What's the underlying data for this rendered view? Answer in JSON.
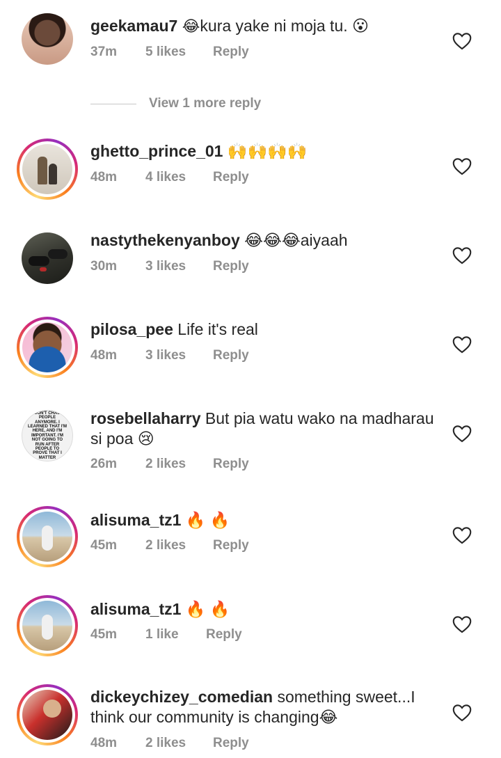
{
  "view_more": "View 1 more reply",
  "comments": [
    {
      "user": "geekamau7",
      "pre": "😂",
      "text": "kura yake ni moja tu. 😮",
      "time": "37m",
      "likes": "5 likes",
      "reply": "Reply"
    },
    {
      "user": "ghetto_prince_01",
      "pre": "",
      "text": "🙌🙌🙌🙌",
      "time": "48m",
      "likes": "4 likes",
      "reply": "Reply"
    },
    {
      "user": "nastythekenyanboy",
      "pre": "",
      "text": "😂😂😂aiyaah",
      "time": "30m",
      "likes": "3 likes",
      "reply": "Reply"
    },
    {
      "user": "pilosa_pee",
      "pre": "",
      "text": "Life it's real",
      "time": "48m",
      "likes": "3 likes",
      "reply": "Reply"
    },
    {
      "user": "rosebellaharry",
      "pre": "",
      "text": "But pia watu wako na madharau si poa 😢",
      "time": "26m",
      "likes": "2 likes",
      "reply": "Reply"
    },
    {
      "user": "alisuma_tz1",
      "pre": "",
      "text": "🔥 🔥",
      "time": "45m",
      "likes": "2 likes",
      "reply": "Reply"
    },
    {
      "user": "alisuma_tz1",
      "pre": "",
      "text": "🔥 🔥",
      "time": "45m",
      "likes": "1 like",
      "reply": "Reply"
    },
    {
      "user": "dickeychizey_comedian",
      "pre": "",
      "text": "something sweet...I think our community is changing😂",
      "time": "48m",
      "likes": "2 likes",
      "reply": "Reply"
    }
  ],
  "avatar_quote": "I DON'T CHASE PEOPLE ANYMORE. I LEARNED THAT I'M HERE, AND I'M IMPORTANT. I'M NOT GOING TO RUN AFTER PEOPLE TO PROVE THAT I MATTER",
  "colors": {
    "text": "#262626",
    "meta": "#8e8e8e",
    "heart": "#262626"
  }
}
